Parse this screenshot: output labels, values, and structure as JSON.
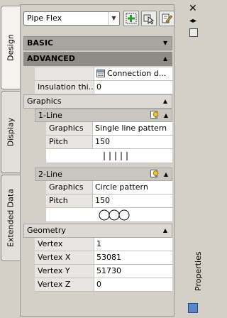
{
  "tabs": [
    "Design",
    "Display",
    "Extended Data"
  ],
  "side_title": "Properties",
  "style_select": {
    "value": "Pipe Flex"
  },
  "categories": {
    "basic": "BASIC",
    "advanced": "ADVANCED",
    "graphics": "Graphics",
    "geometry": "Geometry"
  },
  "advanced": {
    "connection_value": "Connection d...",
    "insulation_label": "Insulation thi...",
    "insulation_value": "0"
  },
  "line1": {
    "header": "1-Line",
    "graphics_label": "Graphics",
    "graphics_value": "Single line pattern",
    "pitch_label": "Pitch",
    "pitch_value": "150"
  },
  "line2": {
    "header": "2-Line",
    "graphics_label": "Graphics",
    "graphics_value": "Circle pattern",
    "pitch_label": "Pitch",
    "pitch_value": "150"
  },
  "geometry": [
    {
      "label": "Vertex",
      "value": "1"
    },
    {
      "label": "Vertex X",
      "value": "53081"
    },
    {
      "label": "Vertex Y",
      "value": "51730"
    },
    {
      "label": "Vertex Z",
      "value": "0"
    }
  ]
}
